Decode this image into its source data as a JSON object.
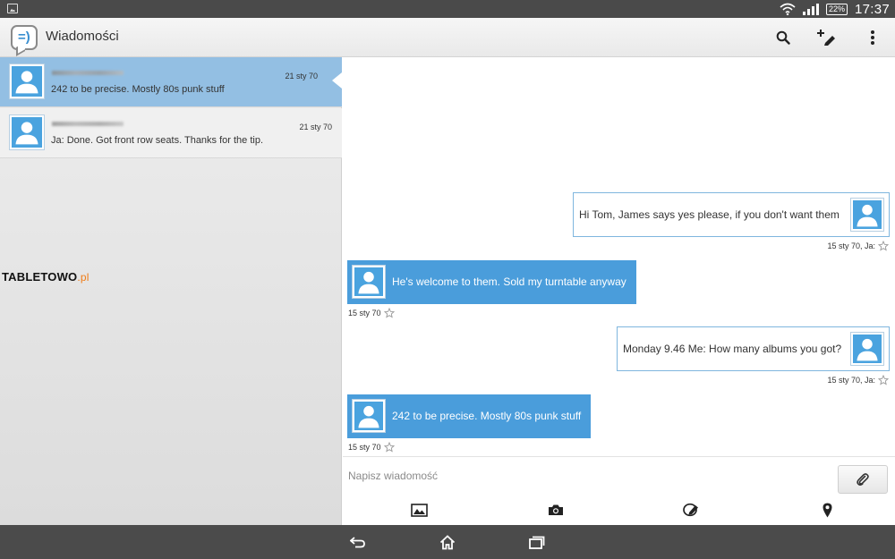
{
  "status_bar": {
    "battery": "22%",
    "time": "17:37"
  },
  "action_bar": {
    "title": "Wiadomości",
    "app_icon_glyph": "=)",
    "icons": [
      "search-icon",
      "new-message-icon",
      "overflow-menu-icon"
    ]
  },
  "conversations": [
    {
      "date": "21 sty 70",
      "preview": "242 to be precise. Mostly 80s punk stuff",
      "selected": true
    },
    {
      "date": "21 sty 70",
      "preview": "Ja: Done. Got front row seats. Thanks for the tip.",
      "selected": false
    }
  ],
  "watermark": {
    "brand": "TABLETOWO",
    "suffix": ".pl"
  },
  "messages": [
    {
      "direction": "out",
      "text": "Hi Tom, James says yes please, if you don't want them",
      "meta": "15 sty 70, Ja:"
    },
    {
      "direction": "in",
      "text": "He's welcome to them. Sold my turntable anyway",
      "meta": "15 sty 70"
    },
    {
      "direction": "out",
      "text": "Monday 9.46 Me: How many albums you got?",
      "meta": "15 sty 70, Ja:"
    },
    {
      "direction": "in",
      "text": "242 to be precise. Mostly 80s punk stuff",
      "meta": "15 sty 70"
    }
  ],
  "compose": {
    "placeholder": "Napisz wiadomość",
    "tools": [
      "gallery-icon",
      "camera-icon",
      "sketch-icon",
      "location-pin-icon"
    ]
  },
  "colors": {
    "accent": "#4a9ddb",
    "selected_row": "#93bfe3",
    "status_bar": "#4a4a4a"
  }
}
